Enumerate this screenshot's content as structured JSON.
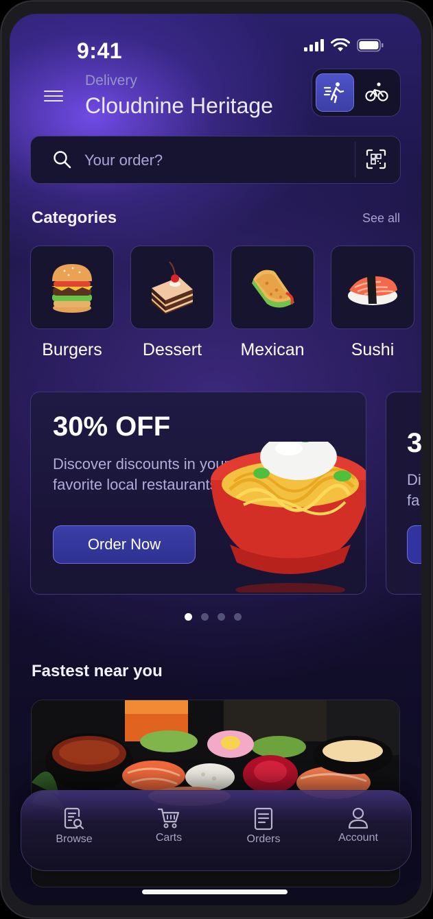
{
  "status_bar": {
    "time": "9:41"
  },
  "header": {
    "delivery_label": "Delivery",
    "location": "Cloudnine Heritage",
    "modes": [
      {
        "icon": "walking-icon",
        "active": true
      },
      {
        "icon": "bicycle-icon",
        "active": false
      }
    ]
  },
  "search": {
    "placeholder": "Your order?",
    "scan_icon": "qr-scan-icon"
  },
  "categories": {
    "title": "Categories",
    "see_all": "See all",
    "items": [
      {
        "label": "Burgers",
        "icon": "burger-icon"
      },
      {
        "label": "Dessert",
        "icon": "cake-icon"
      },
      {
        "label": "Mexican",
        "icon": "taco-icon"
      },
      {
        "label": "Sushi",
        "icon": "sushi-icon"
      }
    ]
  },
  "promo": {
    "title": "30% OFF",
    "text": "Discover discounts in your favorite local restaurants",
    "button": "Order Now",
    "peek_title": "3",
    "peek_text_1": "Di",
    "peek_text_2": "fa",
    "pages": 4,
    "active_page": 1
  },
  "fastest": {
    "title": "Fastest near you"
  },
  "bottom_nav": {
    "items": [
      {
        "label": "Browse",
        "icon": "browse-icon"
      },
      {
        "label": "Carts",
        "icon": "cart-icon"
      },
      {
        "label": "Orders",
        "icon": "orders-icon"
      },
      {
        "label": "Account",
        "icon": "account-icon"
      }
    ]
  },
  "colors": {
    "accent": "#4e53c8",
    "background": "#1a1240",
    "promo_bowl": "#d9302a"
  }
}
